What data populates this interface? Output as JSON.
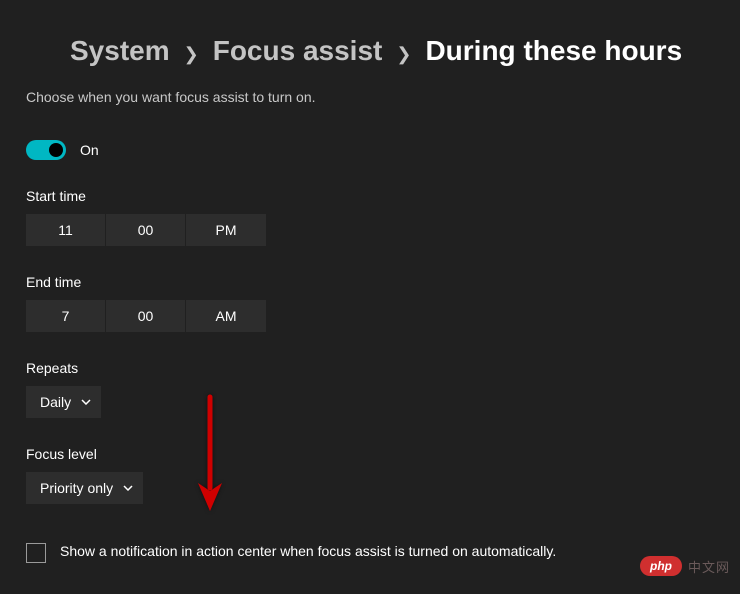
{
  "breadcrumb": {
    "items": [
      {
        "label": "System"
      },
      {
        "label": "Focus assist"
      },
      {
        "label": "During these hours"
      }
    ]
  },
  "description": "Choose when you want focus assist to turn on.",
  "toggle": {
    "state_label": "On",
    "on": true
  },
  "start_time": {
    "label": "Start time",
    "hour": "11",
    "minute": "00",
    "ampm": "PM"
  },
  "end_time": {
    "label": "End time",
    "hour": "7",
    "minute": "00",
    "ampm": "AM"
  },
  "repeats": {
    "label": "Repeats",
    "value": "Daily"
  },
  "focus_level": {
    "label": "Focus level",
    "value": "Priority only"
  },
  "notification_checkbox": {
    "checked": false,
    "label": "Show a notification in action center when focus assist is turned on automatically."
  },
  "watermark": {
    "badge": "php",
    "text": "中文网"
  }
}
